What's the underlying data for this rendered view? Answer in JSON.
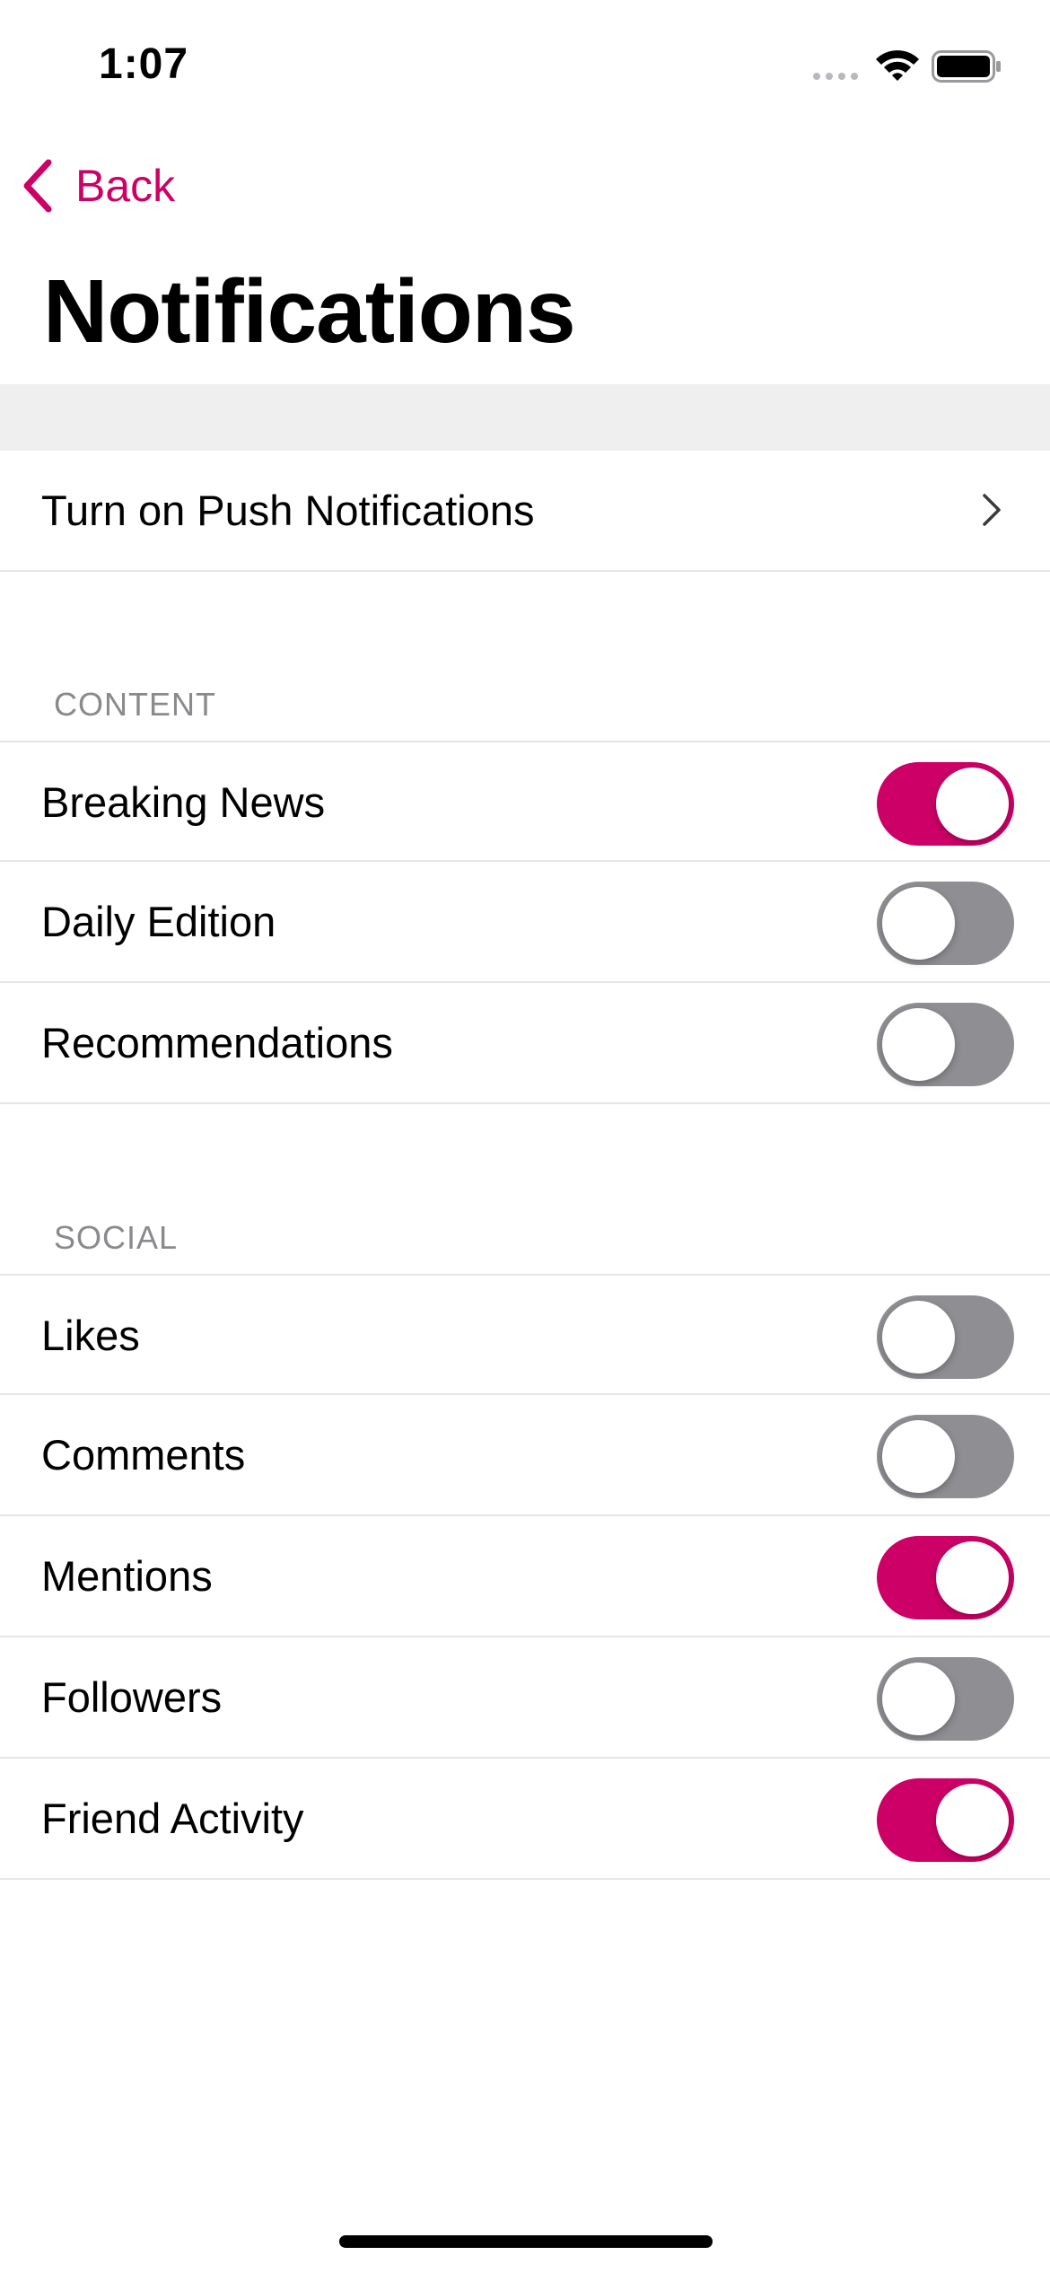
{
  "status_bar": {
    "time": "1:07"
  },
  "nav": {
    "back_label": "Back",
    "title": "Notifications"
  },
  "push": {
    "label": "Turn on Push Notifications"
  },
  "sections": {
    "content": {
      "header": "CONTENT",
      "items": [
        {
          "label": "Breaking News",
          "on": true
        },
        {
          "label": "Daily Edition",
          "on": false
        },
        {
          "label": "Recommendations",
          "on": false
        }
      ]
    },
    "social": {
      "header": "SOCIAL",
      "items": [
        {
          "label": "Likes",
          "on": false
        },
        {
          "label": "Comments",
          "on": false
        },
        {
          "label": "Mentions",
          "on": true
        },
        {
          "label": "Followers",
          "on": false
        },
        {
          "label": "Friend Activity",
          "on": true
        }
      ]
    }
  },
  "colors": {
    "accent": "#cc0066",
    "toggle_off": "#8e8e93",
    "separator": "#e5e5ea",
    "section_header": "#8a8a8e",
    "band": "#efeff0"
  },
  "icons": {
    "back": "chevron-left-icon",
    "disclosure": "chevron-right-icon",
    "wifi": "wifi-icon",
    "battery": "battery-icon",
    "signal": "signal-dots-icon"
  }
}
